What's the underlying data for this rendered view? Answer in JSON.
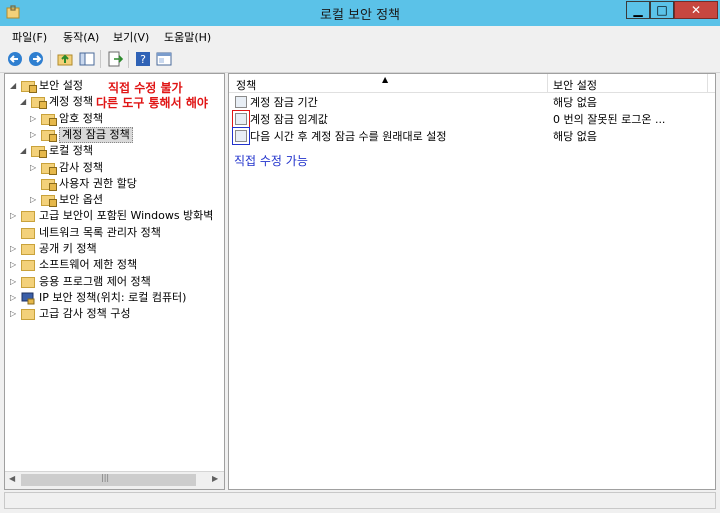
{
  "window": {
    "title": "로컬 보안 정책",
    "min": "▁",
    "max": "□",
    "close": "✕"
  },
  "menu": [
    "파일(F)",
    "동작(A)",
    "보기(V)",
    "도움말(H)"
  ],
  "tree": [
    {
      "label": "보안 설정",
      "indent": 0,
      "tri": "◢",
      "icon": "folder-lock"
    },
    {
      "label": "계정 정책",
      "indent": 1,
      "tri": "◢",
      "icon": "folder-lock"
    },
    {
      "label": "암호 정책",
      "indent": 2,
      "tri": "▷",
      "icon": "folder-lock"
    },
    {
      "label": "계정 잠금 정책",
      "indent": 2,
      "tri": "▷",
      "icon": "folder-lock",
      "selected": true
    },
    {
      "label": "로컬 정책",
      "indent": 1,
      "tri": "◢",
      "icon": "folder-lock"
    },
    {
      "label": "감사 정책",
      "indent": 2,
      "tri": "▷",
      "icon": "folder-lock"
    },
    {
      "label": "사용자 권한 할당",
      "indent": 2,
      "tri": "",
      "icon": "folder-lock"
    },
    {
      "label": "보안 옵션",
      "indent": 2,
      "tri": "▷",
      "icon": "folder-lock"
    },
    {
      "label": "고급 보안이 포함된 Windows 방화벽",
      "indent": 0,
      "tri": "▷",
      "icon": "folder"
    },
    {
      "label": "네트워크 목록 관리자 정책",
      "indent": 0,
      "tri": "",
      "icon": "folder"
    },
    {
      "label": "공개 키 정책",
      "indent": 0,
      "tri": "▷",
      "icon": "folder"
    },
    {
      "label": "소프트웨어 제한 정책",
      "indent": 0,
      "tri": "▷",
      "icon": "folder"
    },
    {
      "label": "응용 프로그램 제어 정책",
      "indent": 0,
      "tri": "▷",
      "icon": "folder"
    },
    {
      "label": "IP 보안 정책(위치: 로컬 컴퓨터)",
      "indent": 0,
      "tri": "▷",
      "icon": "ip-security"
    },
    {
      "label": "고급 감사 정책 구성",
      "indent": 0,
      "tri": "▷",
      "icon": "folder"
    }
  ],
  "hscroll": {
    "thumb": "|||",
    "left": "◀",
    "right": "▶"
  },
  "columns": {
    "policy": "정책",
    "setting": "보안 설정",
    "sort": "▲"
  },
  "policies": [
    {
      "name": "계정 잠금 기간",
      "value": "해당 없음"
    },
    {
      "name": "계정 잠금 임계값",
      "value": "0 번의 잘못된 로그온 ..."
    },
    {
      "name": "다음 시간 후 계정 잠금 수를 원래대로 설정",
      "value": "해당 없음"
    }
  ],
  "annotations": {
    "red_line1": "직접 수정 불가",
    "red_line2": "다른 도구 통해서 해야",
    "blue": "직접 수정 가능"
  },
  "colors": {
    "titlebar": "#5bc2e8",
    "annotation_red": "#e01515",
    "annotation_blue": "#2233cc"
  }
}
